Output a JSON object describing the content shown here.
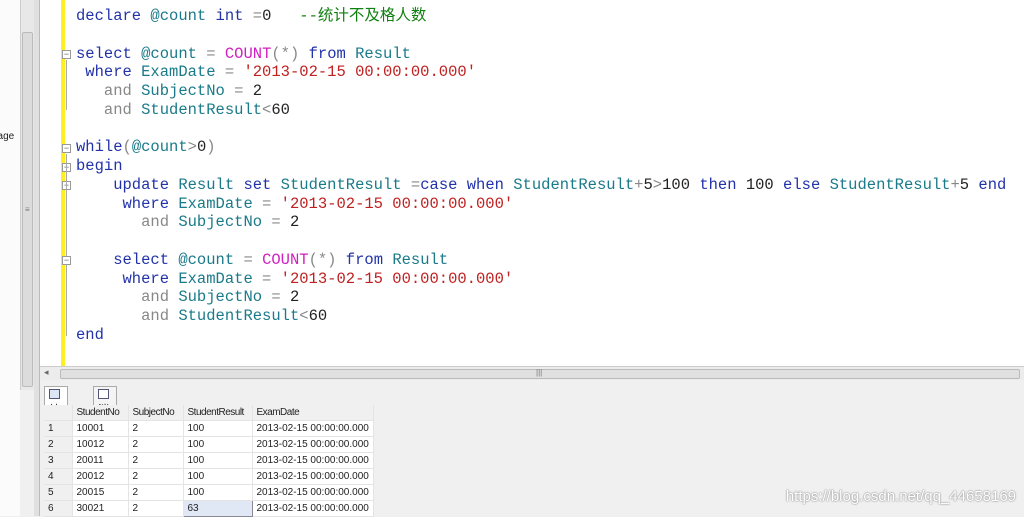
{
  "left_panel_text": "nage",
  "code_lines": [
    [
      [
        "kw",
        "declare "
      ],
      [
        "id",
        "@count "
      ],
      [
        "kw",
        "int "
      ],
      [
        "op",
        "="
      ],
      [
        "tx",
        "0   "
      ],
      [
        "cm",
        "--统计不及格人数"
      ]
    ],
    [],
    [
      [
        "kw",
        "select "
      ],
      [
        "id",
        "@count "
      ],
      [
        "op",
        "= "
      ],
      [
        "fn",
        "COUNT"
      ],
      [
        "op",
        "(*) "
      ],
      [
        "kw",
        "from "
      ],
      [
        "id",
        "Result"
      ]
    ],
    [
      [
        "kw",
        " where "
      ],
      [
        "id",
        "ExamDate "
      ],
      [
        "op",
        "= "
      ],
      [
        "str",
        "'2013-02-15 00:00:00.000'"
      ]
    ],
    [
      [
        "op",
        "   and "
      ],
      [
        "id",
        "SubjectNo "
      ],
      [
        "op",
        "= "
      ],
      [
        "tx",
        "2"
      ]
    ],
    [
      [
        "op",
        "   and "
      ],
      [
        "id",
        "StudentResult"
      ],
      [
        "op",
        "<"
      ],
      [
        "tx",
        "60"
      ]
    ],
    [],
    [
      [
        "kw",
        "while"
      ],
      [
        "op",
        "("
      ],
      [
        "id",
        "@count"
      ],
      [
        "op",
        ">"
      ],
      [
        "tx",
        "0"
      ],
      [
        "op",
        ")"
      ]
    ],
    [
      [
        "kw",
        "begin"
      ]
    ],
    [
      [
        "kw",
        "    update "
      ],
      [
        "id",
        "Result "
      ],
      [
        "kw",
        "set "
      ],
      [
        "id",
        "StudentResult "
      ],
      [
        "op",
        "="
      ],
      [
        "kw",
        "case when "
      ],
      [
        "id",
        "StudentResult"
      ],
      [
        "op",
        "+"
      ],
      [
        "tx",
        "5"
      ],
      [
        "op",
        ">"
      ],
      [
        "tx",
        "100 "
      ],
      [
        "kw",
        "then "
      ],
      [
        "tx",
        "100 "
      ],
      [
        "kw",
        "else "
      ],
      [
        "id",
        "StudentResult"
      ],
      [
        "op",
        "+"
      ],
      [
        "tx",
        "5 "
      ],
      [
        "kw",
        "end"
      ]
    ],
    [
      [
        "kw",
        "     where "
      ],
      [
        "id",
        "ExamDate "
      ],
      [
        "op",
        "= "
      ],
      [
        "str",
        "'2013-02-15 00:00:00.000'"
      ]
    ],
    [
      [
        "op",
        "       and "
      ],
      [
        "id",
        "SubjectNo "
      ],
      [
        "op",
        "= "
      ],
      [
        "tx",
        "2"
      ]
    ],
    [],
    [
      [
        "kw",
        "    select "
      ],
      [
        "id",
        "@count "
      ],
      [
        "op",
        "= "
      ],
      [
        "fn",
        "COUNT"
      ],
      [
        "op",
        "(*) "
      ],
      [
        "kw",
        "from "
      ],
      [
        "id",
        "Result"
      ]
    ],
    [
      [
        "kw",
        "     where "
      ],
      [
        "id",
        "ExamDate "
      ],
      [
        "op",
        "= "
      ],
      [
        "str",
        "'2013-02-15 00:00:00.000'"
      ]
    ],
    [
      [
        "op",
        "       and "
      ],
      [
        "id",
        "SubjectNo "
      ],
      [
        "op",
        "= "
      ],
      [
        "tx",
        "2"
      ]
    ],
    [
      [
        "op",
        "       and "
      ],
      [
        "id",
        "StudentResult"
      ],
      [
        "op",
        "<"
      ],
      [
        "tx",
        "60"
      ]
    ],
    [
      [
        "kw",
        "end"
      ]
    ]
  ],
  "tabs": {
    "results": "结果",
    "messages": "消息"
  },
  "grid": {
    "columns": [
      "StudentNo",
      "SubjectNo",
      "StudentResult",
      "ExamDate"
    ],
    "rows": [
      [
        "1",
        "10001",
        "2",
        "100",
        "2013-02-15 00:00:00.000"
      ],
      [
        "2",
        "10012",
        "2",
        "100",
        "2013-02-15 00:00:00.000"
      ],
      [
        "3",
        "20011",
        "2",
        "100",
        "2013-02-15 00:00:00.000"
      ],
      [
        "4",
        "20012",
        "2",
        "100",
        "2013-02-15 00:00:00.000"
      ],
      [
        "5",
        "20015",
        "2",
        "100",
        "2013-02-15 00:00:00.000"
      ],
      [
        "6",
        "30021",
        "2",
        "63",
        "2013-02-15 00:00:00.000"
      ]
    ]
  },
  "watermark": "https://blog.csdn.net/qq_44658169"
}
